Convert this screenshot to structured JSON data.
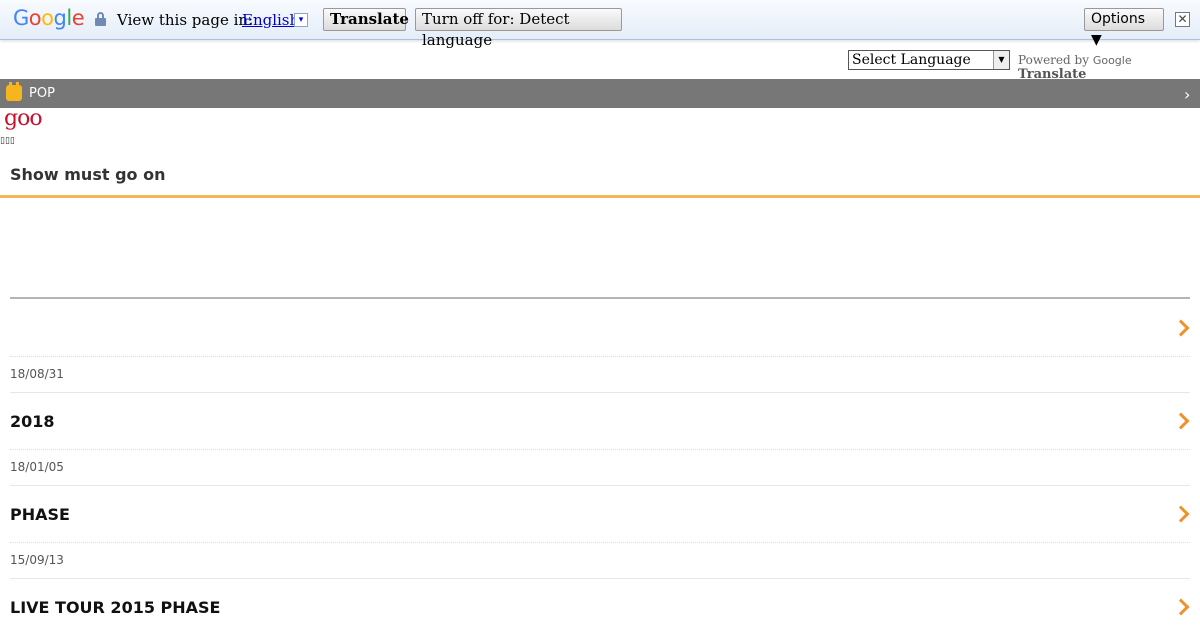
{
  "translate_bar": {
    "logo_letters": [
      {
        "ch": "G",
        "color": "#4285f4"
      },
      {
        "ch": "o",
        "color": "#ea4335"
      },
      {
        "ch": "o",
        "color": "#fbbc05"
      },
      {
        "ch": "g",
        "color": "#4285f4"
      },
      {
        "ch": "l",
        "color": "#34a853"
      },
      {
        "ch": "e",
        "color": "#ea4335"
      }
    ],
    "view_label": "View this page in:",
    "language": "English",
    "language_arrow": "▾",
    "translate_button": "Translate",
    "turnoff_button": "Turn off for: Detect language",
    "options_button": "Options ▼",
    "close_glyph": "✕"
  },
  "language_select": {
    "value": "Select Language",
    "arrow": "▼",
    "powered_by": "Powered by",
    "powered_google": "Google",
    "powered_translate": "Translate"
  },
  "category": {
    "label": "POP",
    "chevron": "›",
    "icon": "tv-icon"
  },
  "brand": "goo",
  "tofu": "▯▯▯",
  "page_title": "Show must go on",
  "colors": {
    "accent_orange": "#f5b55a",
    "chevron_orange": "#f0922b",
    "category_bar": "#777777"
  },
  "entries": [
    {
      "date": "18/08/31",
      "title": "2018"
    },
    {
      "date": "18/01/05",
      "title": "PHASE"
    },
    {
      "date": "15/09/13",
      "title": "LIVE TOUR 2015 PHASE"
    }
  ]
}
